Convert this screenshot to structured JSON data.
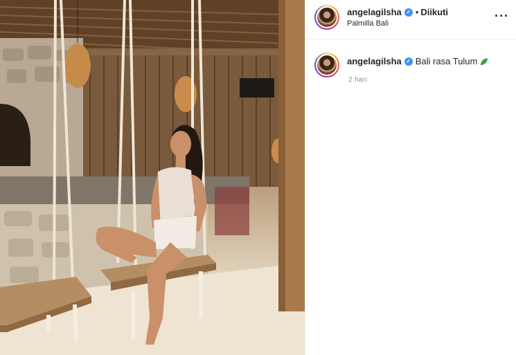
{
  "post": {
    "username": "angelagilsha",
    "follow_status": "Diikuti",
    "separator": "•",
    "location": "Palmilla Bali",
    "more_icon": "more-options-icon",
    "caption_username": "angelagilsha",
    "caption": "Bali rasa Tulum",
    "caption_emoji": "leaf-icon",
    "timestamp": "2 hari"
  },
  "colors": {
    "verified": "#3897f0",
    "text": "#262626",
    "muted": "#8e8e8e",
    "divider": "#efefef"
  }
}
